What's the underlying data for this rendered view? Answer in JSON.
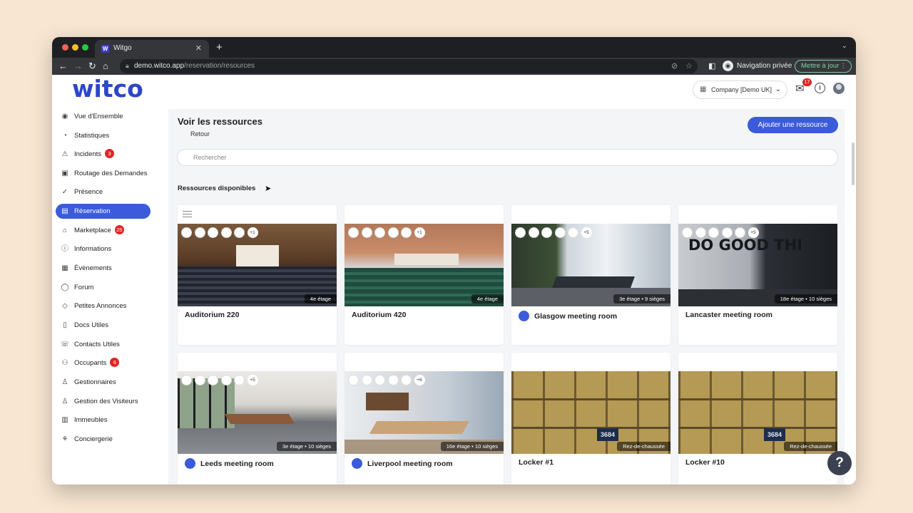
{
  "browser": {
    "tab_title": "Witgo",
    "tab_close": "✕",
    "new_tab": "+",
    "url_host": "demo.witco.app",
    "url_path": "/reservation/resources",
    "private_label": "Navigation privée",
    "update_label": "Mettre à jour"
  },
  "header": {
    "logo": "witco",
    "company_selector": "Company [Demo UK]",
    "mail_badge": "17"
  },
  "sidebar": {
    "items": [
      {
        "label": "Vue d'Ensemble",
        "icon": "eye-icon",
        "badge": ""
      },
      {
        "label": "Statistiques",
        "icon": "pie-chart-icon",
        "badge": ""
      },
      {
        "label": "Incidents",
        "icon": "warning-icon",
        "badge": "3"
      },
      {
        "label": "Routage des Demandes",
        "icon": "contact-card-icon",
        "badge": ""
      },
      {
        "label": "Présence",
        "icon": "check-circle-icon",
        "badge": ""
      },
      {
        "label": "Réservation",
        "icon": "calendar-icon",
        "badge": "",
        "active": true
      },
      {
        "label": "Marketplace",
        "icon": "shop-icon",
        "badge": "25"
      },
      {
        "label": "Informations",
        "icon": "info-icon",
        "badge": ""
      },
      {
        "label": "Évènements",
        "icon": "calendar-event-icon",
        "badge": ""
      },
      {
        "label": "Forum",
        "icon": "chat-bubble-icon",
        "badge": ""
      },
      {
        "label": "Petites Annonces",
        "icon": "tag-icon",
        "badge": ""
      },
      {
        "label": "Docs Utiles",
        "icon": "document-icon",
        "badge": ""
      },
      {
        "label": "Contacts Utiles",
        "icon": "phone-icon",
        "badge": ""
      },
      {
        "label": "Occupants",
        "icon": "users-icon",
        "badge": "6"
      },
      {
        "label": "Gestionnaires",
        "icon": "user-icon",
        "badge": ""
      },
      {
        "label": "Gestion des Visiteurs",
        "icon": "visitor-icon",
        "badge": ""
      },
      {
        "label": "Immeubles",
        "icon": "building-icon",
        "badge": ""
      },
      {
        "label": "Conciergerie",
        "icon": "concierge-icon",
        "badge": ""
      }
    ]
  },
  "main": {
    "title": "Voir les ressources",
    "back_label": "Retour",
    "add_button": "Ajouter une ressource",
    "search_placeholder": "Rechercher",
    "section_title": "Ressources disponibles",
    "resources": [
      {
        "name": "Auditorium 220",
        "meta": "4e étage",
        "more": "+1",
        "dot": false
      },
      {
        "name": "Auditorium 420",
        "meta": "4e étage",
        "more": "+1",
        "dot": false
      },
      {
        "name": "Glasgow meeting room",
        "meta": "3e étage  •  9 sièges",
        "more": "+5",
        "dot": true
      },
      {
        "name": "Lancaster meeting room",
        "meta": "18e étage  •  10 sièges",
        "more": "+5",
        "dot": false
      },
      {
        "name": "Leeds meeting room",
        "meta": "3e étage  •  10 sièges",
        "more": "+5",
        "dot": true
      },
      {
        "name": "Liverpool meeting room",
        "meta": "16e étage  •  10 sièges",
        "more": "+6",
        "dot": true
      },
      {
        "name": "Locker #1",
        "meta": "Rez-de-chaussée",
        "more": "",
        "dot": false
      },
      {
        "name": "Locker #10",
        "meta": "Rez-de-chaussée",
        "more": "",
        "dot": false
      }
    ],
    "lancaster_wall_text": "DO GOOD THI",
    "locker_plate": "3684"
  },
  "help_label": "?"
}
